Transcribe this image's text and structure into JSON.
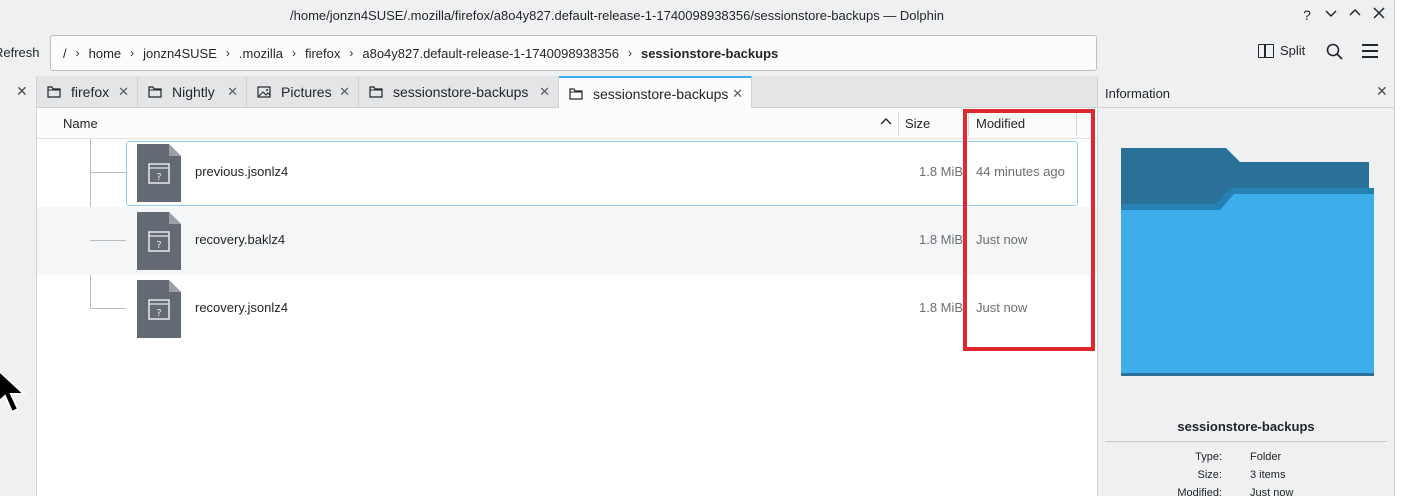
{
  "window": {
    "title": "/home/jonzn4SUSE/.mozilla/firefox/a8o4y827.default-release-1-1740098938356/sessionstore-backups — Dolphin"
  },
  "toolbar": {
    "refresh_label": "Refresh",
    "split_label": "Split",
    "breadcrumb": [
      "/",
      "home",
      "jonzn4SUSE",
      ".mozilla",
      "firefox",
      "a8o4y827.default-release-1-1740098938356",
      "sessionstore-backups"
    ]
  },
  "tabs": [
    {
      "label": "firefox",
      "icon": "folder-icon"
    },
    {
      "label": "Nightly",
      "icon": "folder-icon"
    },
    {
      "label": "Pictures",
      "icon": "image-folder-icon"
    },
    {
      "label": "sessionstore-backups",
      "icon": "folder-icon"
    },
    {
      "label": "sessionstore-backups",
      "icon": "folder-icon",
      "active": true
    }
  ],
  "columns": {
    "name": "Name",
    "size": "Size",
    "modified": "Modified"
  },
  "files": [
    {
      "name": "previous.jsonlz4",
      "size": "1.8 MiB",
      "modified": "44 minutes ago",
      "selected": true
    },
    {
      "name": "recovery.baklz4",
      "size": "1.8 MiB",
      "modified": "Just now"
    },
    {
      "name": "recovery.jsonlz4",
      "size": "1.8 MiB",
      "modified": "Just now"
    }
  ],
  "info": {
    "title": "Information",
    "name": "sessionstore-backups",
    "type_label": "Type:",
    "type_value": "Folder",
    "size_label": "Size:",
    "size_value": "3 items",
    "modified_label": "Modified:",
    "modified_value": "Just now"
  },
  "colors": {
    "accent": "#3daee9",
    "highlight": "#e0282e",
    "folder_front": "#3daee9",
    "folder_back": "#2a7099"
  }
}
